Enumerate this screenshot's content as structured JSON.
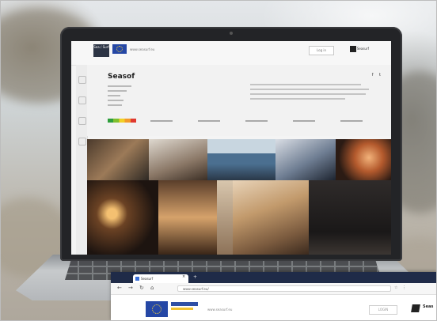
{
  "laptop_site": {
    "header_label": "Sea / Surf",
    "header_small_text": "www.seasurf.eu",
    "login_label": "Log in",
    "user_label": "Seasurf",
    "title": "Seasof",
    "share_icons": "f t"
  },
  "browser": {
    "tab_title": "Seasurf",
    "tab_close": "×",
    "new_tab": "+",
    "nav_back": "←",
    "nav_forward": "→",
    "nav_reload": "↻",
    "nav_home": "⌂",
    "address": "www.seasurf.eu/",
    "address_icons": "☆ ⋮",
    "page_small_text": "www.seasurf.eu",
    "login_label": "LOGIN",
    "brand_text": "Seas"
  }
}
